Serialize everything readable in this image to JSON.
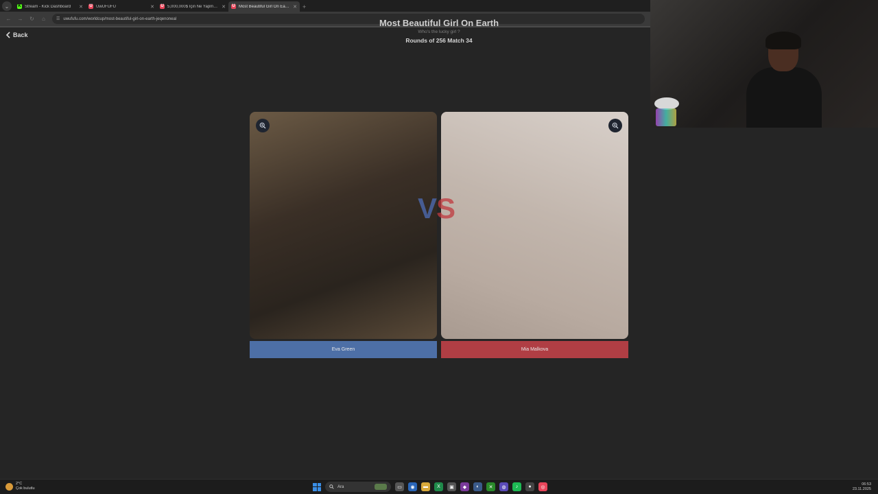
{
  "browser": {
    "tabs": [
      {
        "title": "Stream - Kick Dashboard",
        "favicon": "K",
        "color": "#53fc18",
        "active": false
      },
      {
        "title": "UwUFUFU",
        "favicon": "U",
        "color": "#e8455a",
        "active": false
      },
      {
        "title": "5,000,000$ İçin Ne Yapmazsın ...",
        "favicon": "U",
        "color": "#e8455a",
        "active": false
      },
      {
        "title": "Most Beautiful Girl On Earth |...",
        "favicon": "U",
        "color": "#e8455a",
        "active": true
      }
    ],
    "url": "uwufufu.com/worldcup/most-beautiful-girl-on-earth-jeqenoneal"
  },
  "page": {
    "back_label": "Back",
    "title": "Most Beautiful Girl On Earth",
    "subtitle": "Who's the lucky girl ?",
    "round": "Rounds of 256 Match 34",
    "vs_v": "V",
    "vs_s": "S",
    "left": {
      "name": "Eva Green",
      "color": "#4d6fa6"
    },
    "right": {
      "name": "Mia Malkova",
      "color": "#b03e44"
    }
  },
  "taskbar": {
    "weather_temp": "2°C",
    "weather_desc": "Çok bulutlu",
    "search_placeholder": "Ara",
    "time": "06:53",
    "date": "23.11.2025"
  }
}
